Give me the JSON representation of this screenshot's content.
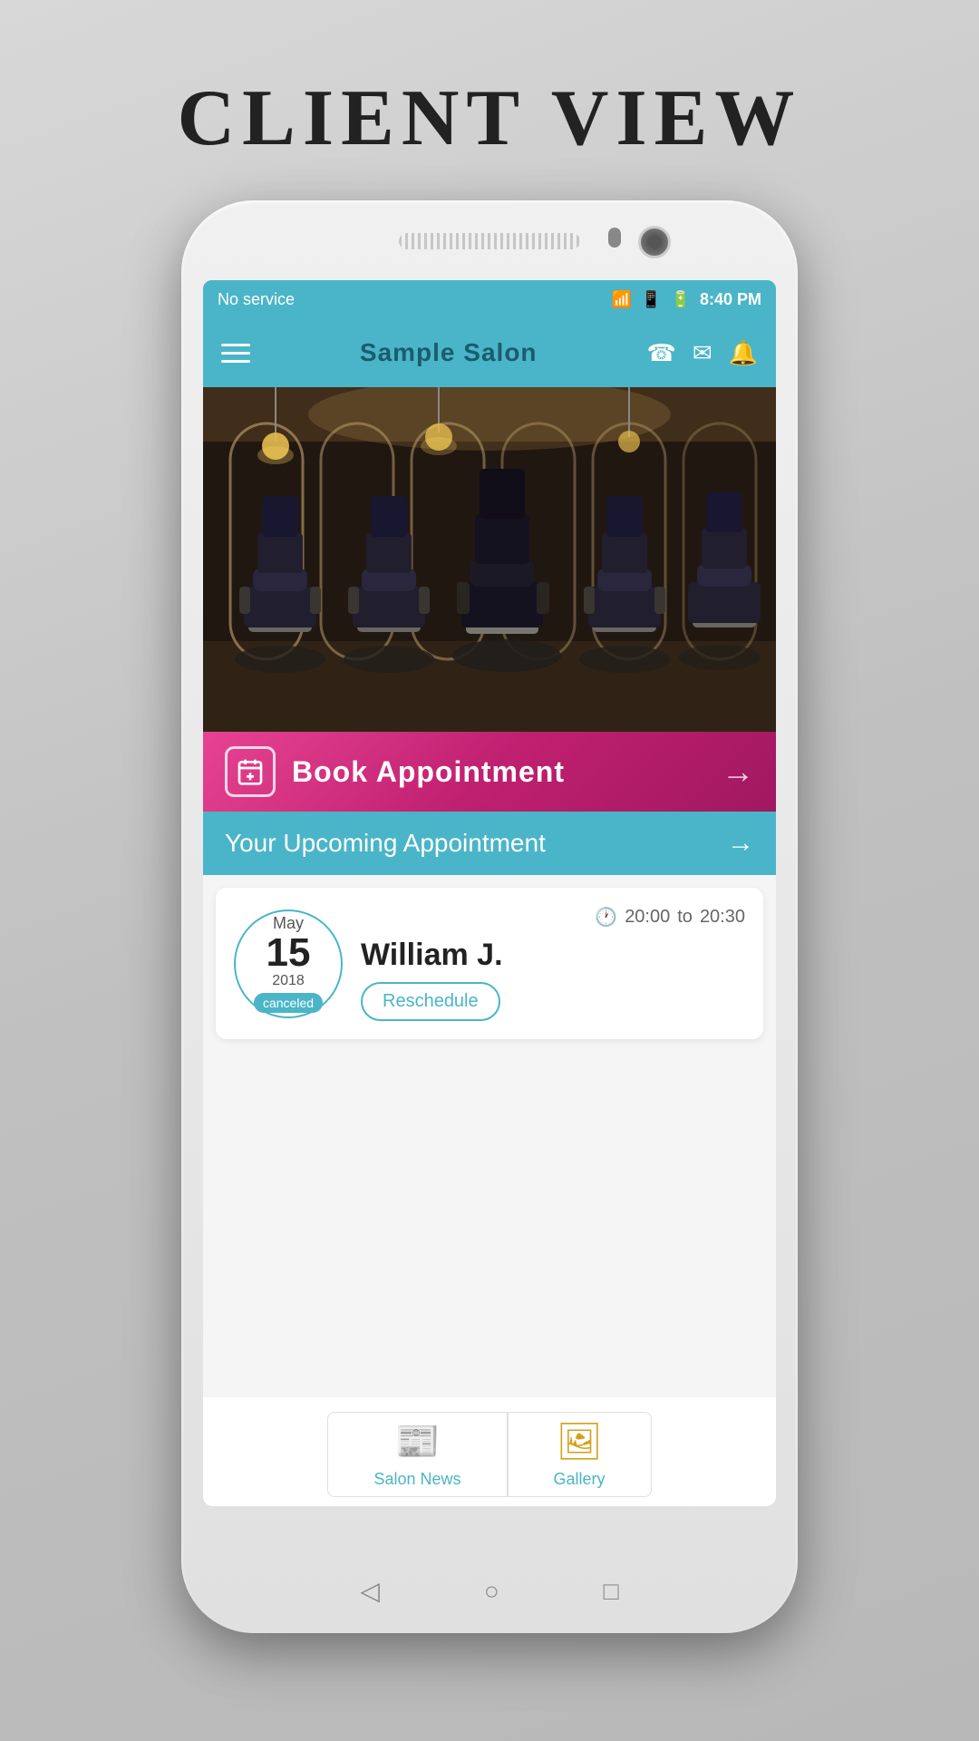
{
  "page": {
    "title": "CLIENT VIEW"
  },
  "status_bar": {
    "carrier": "No service",
    "time": "8:40 PM",
    "wifi_icon": "wifi",
    "battery_icon": "battery"
  },
  "nav": {
    "title": "Sample Salon",
    "menu_icon": "menu",
    "phone_icon": "phone",
    "message_icon": "message",
    "bell_icon": "bell"
  },
  "book_button": {
    "label": "Book Appointment",
    "icon": "calendar-plus",
    "arrow": "→"
  },
  "upcoming": {
    "label": "Your Upcoming Appointment",
    "arrow": "→"
  },
  "appointment": {
    "month": "May",
    "day": "15",
    "year": "2018",
    "status": "canceled",
    "time_from": "20:00",
    "time_to": "20:30",
    "client_name": "William J.",
    "reschedule_label": "Reschedule"
  },
  "bottom_tabs": [
    {
      "id": "salon-news",
      "icon": "📰",
      "label": "Salon News"
    },
    {
      "id": "gallery",
      "icon": "🖼",
      "label": "Gallery"
    }
  ],
  "phone_nav": {
    "back": "◁",
    "home": "○",
    "recent": "□"
  }
}
